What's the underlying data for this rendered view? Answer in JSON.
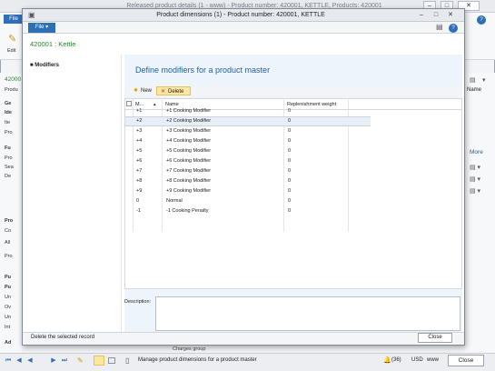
{
  "background_window": {
    "title": "Released product details (1 - www) - Product number: 420001, KETTLE, Products: 420001",
    "file_tab": "File",
    "edit_label": "Edit",
    "record_id": "42000",
    "side_labels": [
      "Produ",
      "Ge",
      "Ide",
      "Ite",
      "Pro",
      "Fu",
      "Pro",
      "Sea",
      "De",
      "Pro",
      "Co",
      "All",
      "Pro",
      "Pu",
      "Pu",
      "Un",
      "Ov",
      "Un",
      "Int",
      "Ad"
    ],
    "right_labels": [
      "Name",
      "More"
    ],
    "charges_group": "Charges group",
    "status": {
      "record_count": "(36)",
      "currency": "USD",
      "company": "www",
      "message": "Manage product dimensions for a product master",
      "close_label": "Close"
    }
  },
  "dialog": {
    "title": "Product dimensions (1) - Product number: 420001, KETTLE",
    "file_tab": "File",
    "header": "420001 : Kettle",
    "nav": {
      "modifiers": "Modifiers"
    },
    "heading": "Define modifiers for a product master",
    "toolbar": {
      "new_label": "New",
      "delete_label": "Delete"
    },
    "grid": {
      "columns": [
        "M...",
        "Name",
        "Replenishment weight"
      ],
      "rows": [
        {
          "m": "+1",
          "name": "+1 Cooking Modifier",
          "weight": "0"
        },
        {
          "m": "+2",
          "name": "+2 Cooking Modifier",
          "weight": "0"
        },
        {
          "m": "+3",
          "name": "+3 Cooking Modifier",
          "weight": "0"
        },
        {
          "m": "+4",
          "name": "+4 Cooking Modifier",
          "weight": "0"
        },
        {
          "m": "+5",
          "name": "+5 Cooking Modifier",
          "weight": "0"
        },
        {
          "m": "+6",
          "name": "+6 Cooking Modifier",
          "weight": "0"
        },
        {
          "m": "+7",
          "name": "+7 Cooking Modifier",
          "weight": "0"
        },
        {
          "m": "+8",
          "name": "+8 Cooking Modifier",
          "weight": "0"
        },
        {
          "m": "+9",
          "name": "+9 Cooking Modifier",
          "weight": "0"
        },
        {
          "m": "0",
          "name": "Normal",
          "weight": "0"
        },
        {
          "m": "-1",
          "name": "-1 Cooking Penalty",
          "weight": "0"
        }
      ],
      "selected_row": "+2"
    },
    "description_label": "Description:",
    "status_text": "Delete the selected record",
    "close_label": "Close"
  },
  "colors": {
    "accent": "#2e6fb6",
    "header_green": "#2e7d32",
    "heading_blue": "#1f5f9e",
    "delete_highlight": "#fbe7a2"
  }
}
